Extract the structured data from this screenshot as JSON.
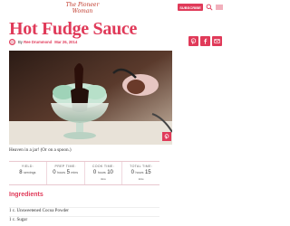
{
  "header": {
    "logo_text": "The Pioneer Woman",
    "subscribe_label": "SUBSCRIBE",
    "menu_label": "MENU"
  },
  "recipe": {
    "title": "Hot Fudge Sauce",
    "author_prefix": "By",
    "author": "Ree Drummond",
    "date": "Mar 26, 2014",
    "caption": "Heaven in a jar! (Or on a spoon.)"
  },
  "meta": {
    "yield_label": "YIELD:",
    "yield_num": "8",
    "yield_unit": "servings",
    "prep_label": "PREP TIME:",
    "prep_h": "0",
    "prep_h_unit": "hours",
    "prep_m": "5",
    "prep_m_unit": "mins",
    "cook_label": "COOK TIME:",
    "cook_h": "0",
    "cook_h_unit": "hours",
    "cook_m": "10",
    "cook_m_unit": "mins",
    "total_label": "TOTAL TIME:",
    "total_h": "0",
    "total_h_unit": "hours",
    "total_m": "15",
    "total_m_unit": "mins"
  },
  "ingredients": {
    "heading": "Ingredients",
    "items": [
      "1 c. Unsweetened Cocoa Powder",
      "1 c. Sugar"
    ]
  },
  "colors": {
    "accent": "#e03a59"
  }
}
